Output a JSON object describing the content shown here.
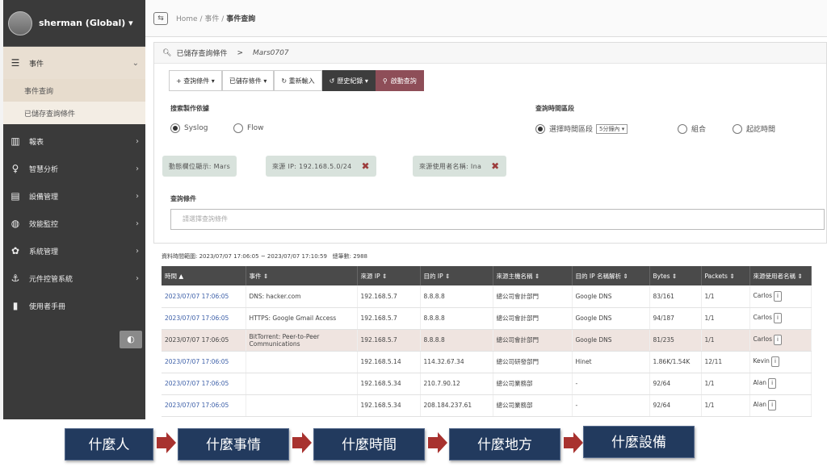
{
  "user": {
    "name": "sherman (Global) ▾"
  },
  "sidebar": {
    "items": [
      {
        "label": "事件",
        "icon": "list-icon"
      },
      {
        "label": "報表",
        "icon": "bar-chart-icon"
      },
      {
        "label": "智慧分析",
        "icon": "lightbulb-icon"
      },
      {
        "label": "設備管理",
        "icon": "server-icon"
      },
      {
        "label": "效能監控",
        "icon": "gauge-icon"
      },
      {
        "label": "系統管理",
        "icon": "gear-icon"
      },
      {
        "label": "元件控管系統",
        "icon": "anchor-icon"
      },
      {
        "label": "使用者手冊",
        "icon": "book-icon"
      }
    ],
    "sub_items": [
      "事件查詢",
      "已儲存查詢條件"
    ]
  },
  "breadcrumb": {
    "home": "Home",
    "sep1": "/",
    "mid": "事件",
    "sep2": "/",
    "current": "事件查詢"
  },
  "saved_query": {
    "label": "已儲存查詢條件",
    "arrow": ">",
    "name": "Mars0707"
  },
  "toolbar": {
    "add": "+ 查詢條件 ▾",
    "saved": "已儲存條件 ▾",
    "reset": "↻ 重新輸入",
    "history": "歷史紀錄 ▾",
    "search": "啟動查詢"
  },
  "source": {
    "label": "搜索製作依據",
    "options": [
      "Syslog",
      "Flow"
    ],
    "selected": "Syslog"
  },
  "time_range": {
    "label": "查詢時間區段",
    "options": [
      "選擇時間區段",
      "組合",
      "起訖時間"
    ],
    "selected": "選擇時間區段",
    "select_value": "5分鐘內"
  },
  "chips": [
    {
      "text": "動態欄位顯示: Mars"
    },
    {
      "text": "來源 IP: 192.168.5.0/24"
    },
    {
      "text": "來源使用者名稱: Ina"
    }
  ],
  "condition": {
    "label": "查詢條件",
    "placeholder": "請選擇查詢條件"
  },
  "result": {
    "range": "資料時間範圍: 2023/07/07 17:06:05 ~ 2023/07/07 17:10:59",
    "total": "總筆數: 2988"
  },
  "table": {
    "headers": [
      "時間 ▲",
      "事件 ⇕",
      "來源 IP ⇕",
      "目的 IP ⇕",
      "來源主機名稱 ⇕",
      "目的 IP 名稱解析 ⇕",
      "Bytes ⇕",
      "Packets ⇕",
      "來源使用者名稱 ⇕"
    ],
    "rows": [
      [
        "2023/07/07 17:06:05",
        "DNS: hacker.com",
        "192.168.5.7",
        "8.8.8.8",
        "總公司會計部門",
        "Google DNS",
        "83/161",
        "1/1",
        "Carlos"
      ],
      [
        "2023/07/07 17:06:05",
        "HTTPS: Google Gmail Access",
        "192.168.5.7",
        "8.8.8.8",
        "總公司會計部門",
        "Google DNS",
        "94/187",
        "1/1",
        "Carlos"
      ],
      [
        "2023/07/07 17:06:05",
        "BitTorrent: Peer-to-Peer Communications",
        "192.168.5.7",
        "8.8.8.8",
        "總公司會計部門",
        "Google DNS",
        "81/235",
        "1/1",
        "Carlos"
      ],
      [
        "2023/07/07 17:06:05",
        "",
        "192.168.5.14",
        "114.32.67.34",
        "總公司研發部門",
        "Hinet",
        "1.86K/1.54K",
        "12/11",
        "Kevin"
      ],
      [
        "2023/07/07 17:06:05",
        "",
        "192.168.5.34",
        "210.7.90.12",
        "總公司業務部",
        "-",
        "92/64",
        "1/1",
        "Alan"
      ],
      [
        "2023/07/07 17:06:05",
        "",
        "192.168.5.34",
        "208.184.237.61",
        "總公司業務部",
        "-",
        "92/64",
        "1/1",
        "Alan"
      ]
    ]
  },
  "flow": [
    "什麼人",
    "什麼事情",
    "什麼時間",
    "什麼地方",
    "什麼設備"
  ],
  "colors": {
    "sidebar": "#3a3a3a",
    "accent": "#8e4e58",
    "flow_box": "#223a5e",
    "arrow": "#a8322f"
  }
}
